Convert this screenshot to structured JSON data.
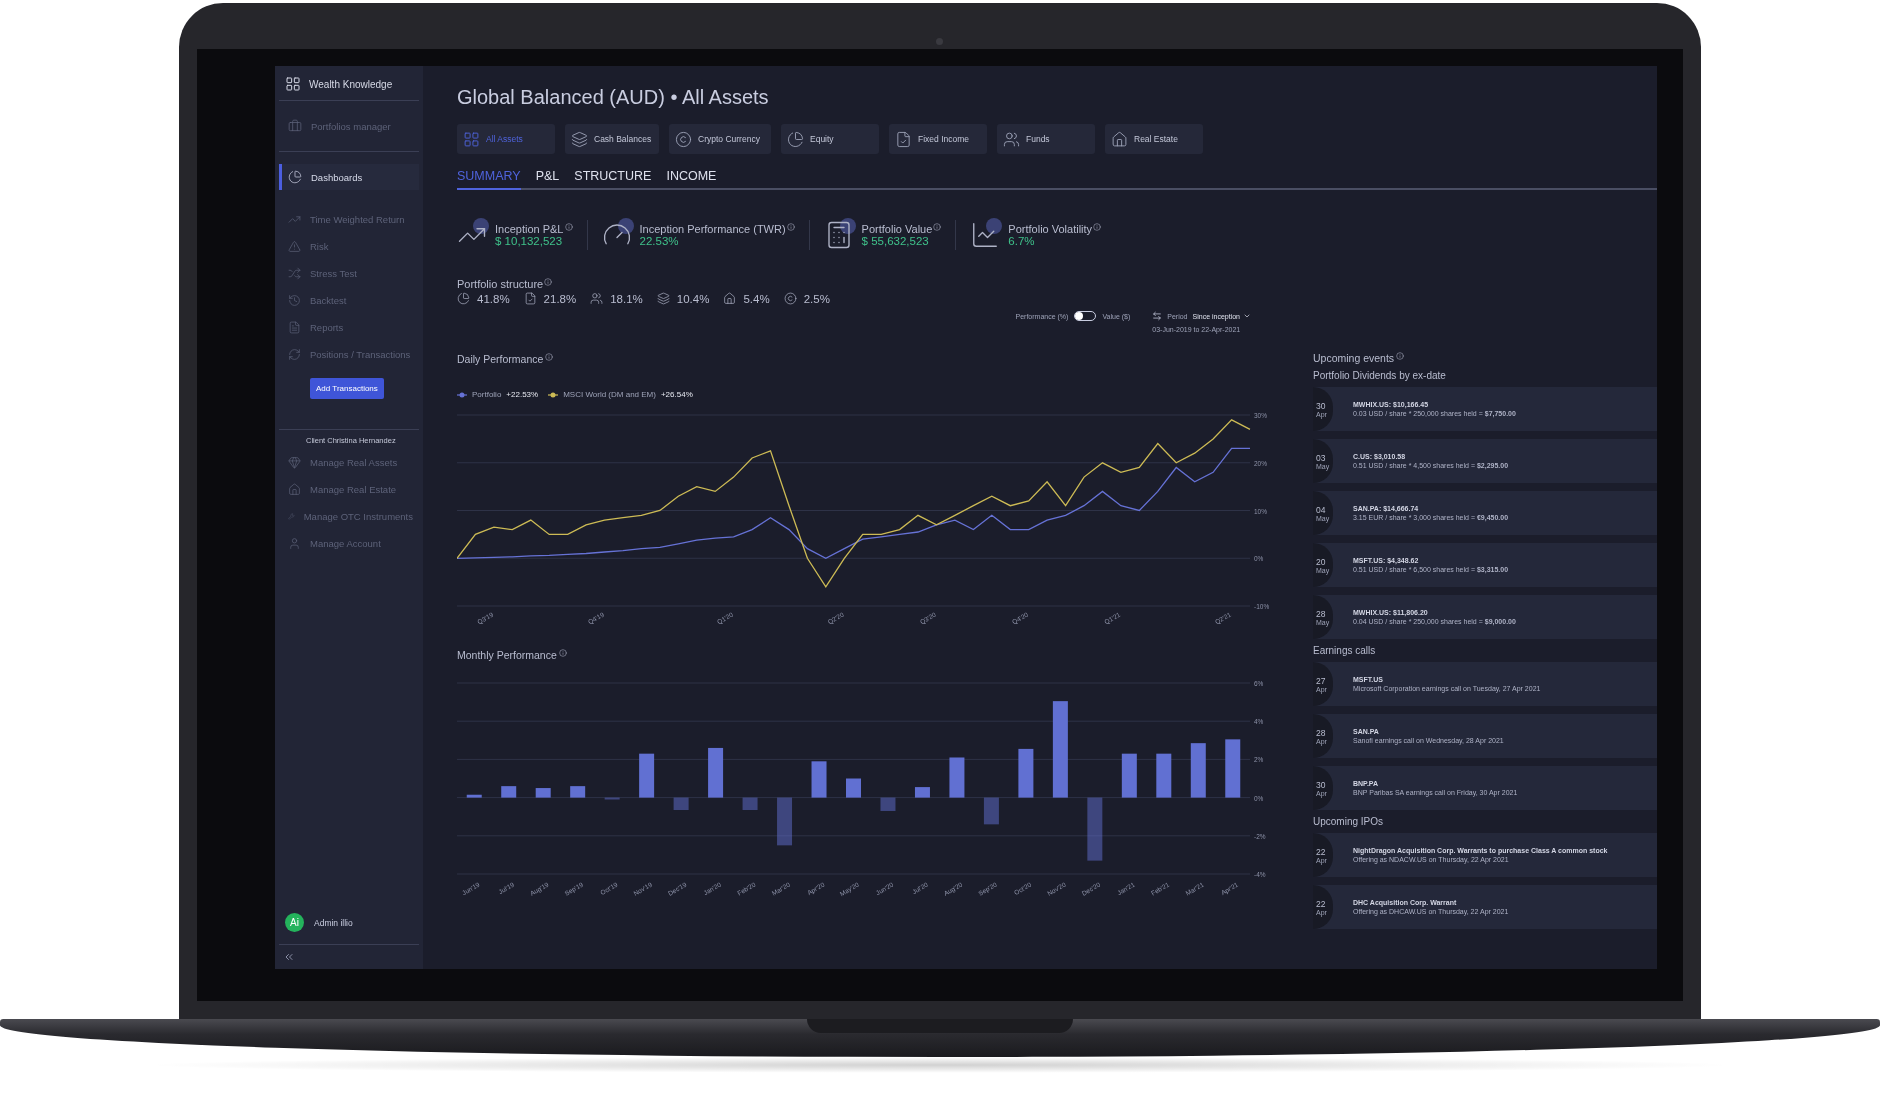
{
  "sidebar": {
    "brand": "Wealth Knowledge",
    "nav": [
      {
        "label": "Portfolios manager",
        "selected": false
      },
      {
        "label": "Dashboards",
        "selected": true
      }
    ],
    "dashboard_items": [
      "Time Weighted Return",
      "Risk",
      "Stress Test",
      "Backtest",
      "Reports",
      "Positions / Transactions"
    ],
    "add_button": "Add Transactions",
    "client_label": "Client Christina Hernandez",
    "client_items": [
      "Manage Real Assets",
      "Manage Real Estate",
      "Manage OTC Instruments",
      "Manage Account"
    ],
    "user": {
      "initials": "Ai",
      "name": "Admin illio"
    }
  },
  "title": "Global Balanced (AUD) • All Assets",
  "asset_tabs": [
    {
      "label": "All Assets",
      "selected": true
    },
    {
      "label": "Cash Balances",
      "selected": false
    },
    {
      "label": "Crypto Currency",
      "selected": false
    },
    {
      "label": "Equity",
      "selected": false
    },
    {
      "label": "Fixed Income",
      "selected": false
    },
    {
      "label": "Funds",
      "selected": false
    },
    {
      "label": "Real Estate",
      "selected": false
    }
  ],
  "view_tabs": [
    {
      "label": "SUMMARY",
      "selected": true
    },
    {
      "label": "P&L",
      "selected": false
    },
    {
      "label": "STRUCTURE",
      "selected": false
    },
    {
      "label": "INCOME",
      "selected": false
    }
  ],
  "kpis": [
    {
      "label": "Inception P&L",
      "value": "$ 10,132,523"
    },
    {
      "label": "Inception Performance (TWR)",
      "value": "22.53%"
    },
    {
      "label": "Portfolio Value",
      "value": "$ 55,632,523"
    },
    {
      "label": "Portfolio Volatility",
      "value": "6.7%"
    }
  ],
  "structure": {
    "title": "Portfolio structure",
    "items": [
      "41.8%",
      "21.8%",
      "18.1%",
      "10.4%",
      "5.4%",
      "2.5%"
    ]
  },
  "toggle": {
    "left_label": "Performance (%)",
    "right_label": "Value ($)",
    "on": false
  },
  "period": {
    "label": "Period",
    "value": "Since inception",
    "range": "03-Jun-2019 to 22-Apr-2021"
  },
  "daily": {
    "title": "Daily Performance",
    "legend_values": [
      "+22.53%",
      "+26.54%"
    ],
    "chart_data": {
      "type": "line",
      "categories": [
        null,
        null,
        "Q3'19",
        null,
        null,
        null,
        null,
        null,
        "Q4'19",
        null,
        null,
        null,
        null,
        null,
        null,
        "Q1'20",
        null,
        null,
        null,
        null,
        null,
        "Q2'20",
        null,
        null,
        null,
        null,
        "Q3'20",
        null,
        null,
        null,
        null,
        "Q4'20",
        null,
        null,
        null,
        null,
        "Q1'21",
        null,
        null,
        null,
        null,
        null,
        "Q2'21",
        null
      ],
      "series": [
        {
          "name": "Portfolio",
          "color": "#6672d6",
          "values": [
            0,
            0.1,
            0.2,
            0.3,
            0.5,
            0.6,
            0.8,
            1,
            1.3,
            1.6,
            2,
            2.3,
            3,
            3.8,
            4.2,
            4.5,
            6,
            8.5,
            6,
            2,
            0,
            2,
            4,
            4.5,
            5,
            5.5,
            7,
            8,
            6,
            9,
            6,
            6,
            8,
            9,
            11,
            14,
            11,
            10,
            14,
            19,
            16,
            18,
            23,
            23
          ]
        },
        {
          "name": "MSCI World (DM and EM)",
          "color": "#cdbb55",
          "values": [
            0,
            5,
            6.5,
            6,
            8,
            5,
            5,
            7,
            8,
            8.5,
            9,
            10,
            13,
            15,
            14,
            17,
            21,
            22.5,
            11,
            0,
            -6,
            0,
            5,
            5,
            6,
            9,
            7,
            9,
            11,
            13,
            11,
            12,
            16,
            11,
            17,
            20,
            18,
            19,
            24,
            20,
            22,
            25,
            29,
            27
          ]
        }
      ],
      "ylim": [
        -10,
        30
      ],
      "grid": true,
      "yticks": [
        {
          "value": 30,
          "label": "30%"
        },
        {
          "value": 20,
          "label": "20%"
        },
        {
          "value": 10,
          "label": "10%"
        },
        {
          "value": 0,
          "label": "0%"
        },
        {
          "value": -10,
          "label": "-10%"
        }
      ]
    }
  },
  "monthly": {
    "chart_data": {
      "type": "bar",
      "title": "Monthly Performance",
      "categories": [
        "Jun'19",
        "Jul'19",
        "Aug'19",
        "Sep'19",
        "Oct'19",
        "Nov'19",
        "Dec'19",
        "Jan'20",
        "Feb'20",
        "Mar'20",
        "Apr'20",
        "May'20",
        "Jun'20",
        "Jul'20",
        "Aug'20",
        "Sep'20",
        "Oct'20",
        "Nov'20",
        "Dec'20",
        "Jan'21",
        "Feb'21",
        "Mar'21",
        "Apr'21"
      ],
      "series": [
        {
          "color": "#6170d2",
          "values": [
            0.15,
            0.6,
            0.5,
            0.6,
            -0.1,
            2.3,
            -0.65,
            2.6,
            -0.65,
            -2.5,
            1.9,
            1.0,
            -0.7,
            0.55,
            2.1,
            -1.4,
            2.55,
            5.05,
            -3.3,
            2.3,
            2.3,
            2.85,
            3.05
          ]
        }
      ],
      "ylim": [
        -4,
        6
      ],
      "grid": true,
      "yticks": [
        {
          "value": 6,
          "label": "6%"
        },
        {
          "value": 4,
          "label": "4%"
        },
        {
          "value": 2,
          "label": "2%"
        },
        {
          "value": 0,
          "label": "0%"
        },
        {
          "value": -2,
          "label": "-2%"
        },
        {
          "value": -4,
          "label": "-4%"
        }
      ]
    }
  },
  "events": {
    "title": "Upcoming events",
    "groups": [
      {
        "title": "Portfolio Dividends by ex-date",
        "items": [
          {
            "day": "30",
            "month": "Apr",
            "title": "MWHIX.US: $10,166.45",
            "detail": "0.03 USD / share * 250,000 shares held =",
            "amount": "$7,750.00"
          },
          {
            "day": "03",
            "month": "May",
            "title": "C.US: $3,010.58",
            "detail": "0.51 USD / share * 4,500 shares held =",
            "amount": "$2,295.00"
          },
          {
            "day": "04",
            "month": "May",
            "title": "SAN.PA: $14,666.74",
            "detail": "3.15 EUR / share * 3,000 shares held =",
            "amount": "€9,450.00"
          },
          {
            "day": "20",
            "month": "May",
            "title": "MSFT.US: $4,348.62",
            "detail": "0.51 USD / share * 6,500 shares held =",
            "amount": "$3,315.00"
          },
          {
            "day": "28",
            "month": "May",
            "title": "MWHIX.US: $11,806.20",
            "detail": "0.04 USD / share * 250,000 shares held =",
            "amount": "$9,000.00"
          }
        ]
      },
      {
        "title": "Earnings calls",
        "items": [
          {
            "day": "27",
            "month": "Apr",
            "title": "MSFT.US",
            "detail": "Microsoft Corporation earnings call on Tuesday, 27 Apr 2021"
          },
          {
            "day": "28",
            "month": "Apr",
            "title": "SAN.PA",
            "detail": "Sanofi earnings call on Wednesday, 28 Apr 2021"
          },
          {
            "day": "30",
            "month": "Apr",
            "title": "BNP.PA",
            "detail": "BNP Paribas SA earnings call on Friday, 30 Apr 2021"
          }
        ]
      },
      {
        "title": "Upcoming IPOs",
        "items": [
          {
            "day": "22",
            "month": "Apr",
            "title": "NightDragon Acquisition Corp. Warrants to purchase Class A common stock",
            "detail": "Offering as NDACW.US on Thursday, 22 Apr 2021"
          },
          {
            "day": "22",
            "month": "Apr",
            "title": "DHC Acquisition Corp. Warrant",
            "detail": "Offering as DHCAW.US on Thursday, 22 Apr 2021"
          }
        ]
      }
    ]
  }
}
